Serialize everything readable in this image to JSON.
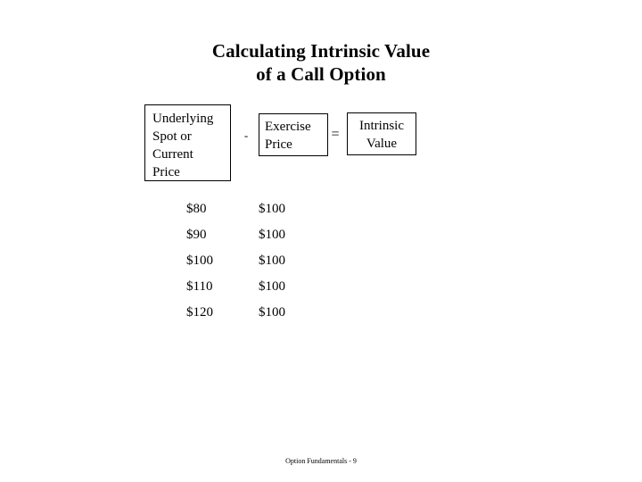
{
  "slide": {
    "title_lines": [
      "Calculating Intrinsic Value",
      "of a Call Option"
    ],
    "footer": "Option Fundamentals - 9",
    "background_color": "#ffffff",
    "text_color": "#000000",
    "border_color": "#000000"
  },
  "formula": {
    "underlying_box": {
      "lines": [
        "Underlying",
        "Spot or",
        "Current",
        "Price"
      ]
    },
    "minus_operator": "-",
    "exercise_box": {
      "lines": [
        "Exercise",
        "Price"
      ]
    },
    "equals_operator": "=",
    "intrinsic_box": {
      "lines": [
        "Intrinsic",
        "Value"
      ]
    }
  },
  "table": {
    "rows": [
      {
        "spot": "$80",
        "strike": "$100",
        "intrinsic": ""
      },
      {
        "spot": "$90",
        "strike": "$100",
        "intrinsic": ""
      },
      {
        "spot": "$100",
        "strike": "$100",
        "intrinsic": ""
      },
      {
        "spot": "$110",
        "strike": "$100",
        "intrinsic": ""
      },
      {
        "spot": "$120",
        "strike": "$100",
        "intrinsic": ""
      }
    ]
  }
}
